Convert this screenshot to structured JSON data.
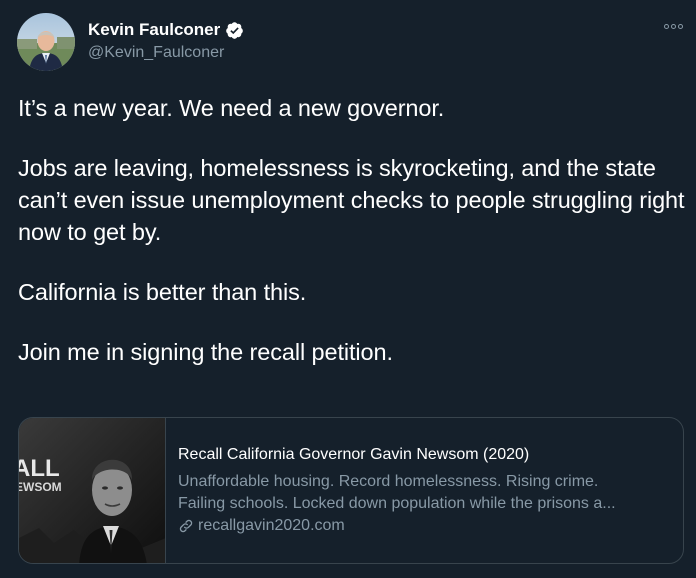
{
  "author": {
    "display_name": "Kevin Faulconer",
    "handle": "@Kevin_Faulconer",
    "verified": true,
    "avatar_icon": "profile-photo"
  },
  "tweet": {
    "paragraphs": [
      "It’s a new year. We need a new governor.",
      "Jobs are leaving, homelessness is skyrocketing, and the state can’t even issue unemployment checks to people struggling right now to get by.",
      "California is better than this.",
      "Join me in signing the recall petition."
    ]
  },
  "link_card": {
    "title": "Recall California Governor Gavin Newsom (2020)",
    "description_line1": "Unaffordable housing. Record homelessness. Rising crime.",
    "description_line2": "Failing schools. Locked down population while the prisons a...",
    "domain": "recallgavin2020.com",
    "thumbnail_text": [
      "ALL",
      "EWSOM"
    ]
  },
  "colors": {
    "background": "#15202b",
    "text": "#ffffff",
    "secondary_text": "#8899a6",
    "border": "#38444d",
    "verified_badge": "#ffffff"
  },
  "icons": [
    "verified-badge-icon",
    "more-options-icon",
    "link-icon"
  ]
}
